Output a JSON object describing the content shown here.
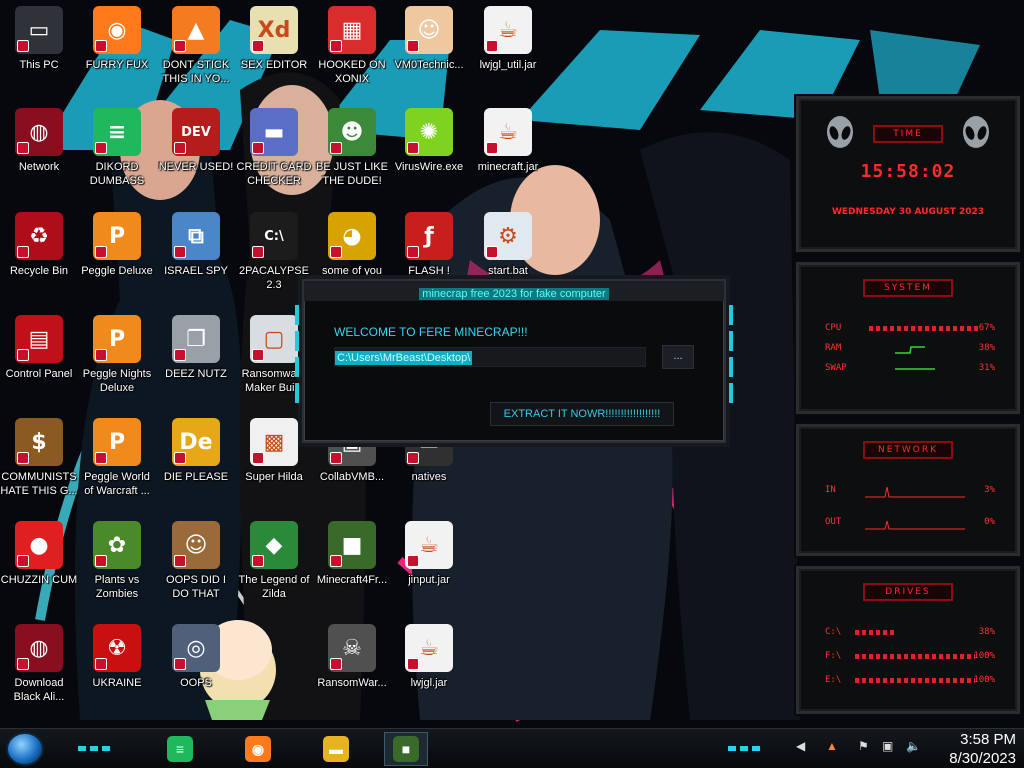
{
  "desktop": {
    "icons": [
      {
        "label": "This PC",
        "icon": "computer-icon",
        "bg": "#30323a"
      },
      {
        "label": "FURRY FUX",
        "icon": "firefox-icon",
        "bg": "#ff7a1a"
      },
      {
        "label": "DONT STICK THIS IN YO...",
        "icon": "traffic-cone-icon",
        "bg": "#f47b20"
      },
      {
        "label": "SEX EDITOR",
        "icon": "hex-editor-icon",
        "bg": "#e8e0b0"
      },
      {
        "label": "HOOKED ON XONIX",
        "icon": "xonix-game-icon",
        "bg": "#d92c2c"
      },
      {
        "label": "VM0Technic...",
        "icon": "doctor-icon",
        "bg": "#f0c8a0"
      },
      {
        "label": "lwjgl_util.jar",
        "icon": "java-icon",
        "bg": "#f2f2f2"
      },
      {
        "label": "Network",
        "icon": "network-icon",
        "bg": "#8a0f1e"
      },
      {
        "label": "DIKORD DUMBASS",
        "icon": "chat-bubble-icon",
        "bg": "#1fb85c"
      },
      {
        "label": "NEVER USED!",
        "icon": "dev-cpp-icon",
        "bg": "#b51c1c"
      },
      {
        "label": "CREDIT CARD CHECKER",
        "icon": "credit-card-icon",
        "bg": "#5a6ec8"
      },
      {
        "label": "BE JUST LIKE THE DUDE!",
        "icon": "santa-face-icon",
        "bg": "#3a8a3a"
      },
      {
        "label": "VirusWire.exe",
        "icon": "lime-icon",
        "bg": "#7ed321"
      },
      {
        "label": "minecraft.jar",
        "icon": "java-icon",
        "bg": "#f2f2f2"
      },
      {
        "label": "Recycle Bin",
        "icon": "recycle-bin-icon",
        "bg": "#b00d1a"
      },
      {
        "label": "Peggle Deluxe",
        "icon": "peggle-icon",
        "bg": "#f08a1c"
      },
      {
        "label": "ISRAEL SPY",
        "icon": "network-computers-icon",
        "bg": "#4a86c8"
      },
      {
        "label": "2PACALYPSE 2.3",
        "icon": "terminal-icon",
        "bg": "#1c1c1c"
      },
      {
        "label": "some of you",
        "icon": "beaver-icon",
        "bg": "#d7a300"
      },
      {
        "label": "FLASH !",
        "icon": "flash-icon",
        "bg": "#c81e1e"
      },
      {
        "label": "start.bat",
        "icon": "gear-script-icon",
        "bg": "#e0e8f0"
      },
      {
        "label": "Control Panel",
        "icon": "control-panel-icon",
        "bg": "#c2101a"
      },
      {
        "label": "Peggle Nights Deluxe",
        "icon": "peggle-icon",
        "bg": "#f08a1c"
      },
      {
        "label": "DEEZ NUTZ",
        "icon": "windows-stack-icon",
        "bg": "#9aa0a8"
      },
      {
        "label": "Ransomware Maker Build",
        "icon": "window-app-icon",
        "bg": "#d8dde2"
      },
      {
        "label": "COMMUNISTS HATE THIS G...",
        "icon": "money-bag-icon",
        "bg": "#8a5a22"
      },
      {
        "label": "Peggle World of Warcraft ...",
        "icon": "peggle-icon",
        "bg": "#f08a1c"
      },
      {
        "label": "DIE PLEASE",
        "icon": "de-icon",
        "bg": "#e6a817"
      },
      {
        "label": "Super Hilda",
        "icon": "pixel-character-icon",
        "bg": "#f0f0f0"
      },
      {
        "label": "CollabVMB...",
        "icon": "collab-icon",
        "bg": "#505050"
      },
      {
        "label": "natives",
        "icon": "folder-icon",
        "bg": "#303030"
      },
      {
        "label": "CHUZZIN CUM",
        "icon": "chuzzle-icon",
        "bg": "#e02020"
      },
      {
        "label": "Plants vs Zombies",
        "icon": "sunflower-icon",
        "bg": "#4a8a2a"
      },
      {
        "label": "OOPS DID I DO THAT",
        "icon": "portrait-icon",
        "bg": "#9a6a3a"
      },
      {
        "label": "The Legend of Zilda",
        "icon": "zelda-icon",
        "bg": "#2a8a3a"
      },
      {
        "label": "Minecraft4Fr...",
        "icon": "grass-block-icon",
        "bg": "#3a6a2a"
      },
      {
        "label": "jinput.jar",
        "icon": "java-icon",
        "bg": "#f2f2f2"
      },
      {
        "label": "Download Black Ali...",
        "icon": "alien-icon",
        "bg": "#8a0f1e"
      },
      {
        "label": "UKRAINE",
        "icon": "radiation-icon",
        "bg": "#c81010"
      },
      {
        "label": "OOPS",
        "icon": "oops-icon",
        "bg": "#50607a"
      },
      {
        "label": "RansomWar...",
        "icon": "skull-icon",
        "bg": "#505050"
      },
      {
        "label": "lwjgl.jar",
        "icon": "java-icon",
        "bg": "#f2f2f2"
      }
    ]
  },
  "window": {
    "title": "minecrap free 2023 for fake computer",
    "welcome": "WELCOME TO FERE MINECRAP!!!",
    "path": "C:\\Users\\MrBeast\\Desktop\\",
    "browse_label": "...",
    "extract_label": "EXTRACT IT NOWR!!!!!!!!!!!!!!!!!!"
  },
  "gadgets": {
    "time": {
      "tag": "TIME",
      "clock": "15:58:02",
      "date": "WEDNESDAY 30 AUGUST 2023"
    },
    "system": {
      "tag": "SYSTEM",
      "rows": [
        {
          "label": "CPU",
          "value": "67%"
        },
        {
          "label": "RAM",
          "value": "38%"
        },
        {
          "label": "SWAP",
          "value": "31%"
        }
      ]
    },
    "network": {
      "tag": "NETWORK",
      "rows": [
        {
          "label": "IN",
          "value": "3%"
        },
        {
          "label": "OUT",
          "value": "0%"
        }
      ]
    },
    "drives": {
      "tag": "DRIVES",
      "rows": [
        {
          "label": "C:\\",
          "value": "38%"
        },
        {
          "label": "F:\\",
          "value": "100%"
        },
        {
          "label": "E:\\",
          "value": "100%"
        }
      ]
    }
  },
  "taskbar": {
    "apps": [
      {
        "name": "Messenger",
        "icon": "chat-bubble-icon",
        "color": "#1fb85c"
      },
      {
        "name": "Firefox",
        "icon": "firefox-icon",
        "color": "#ff7a1a"
      },
      {
        "name": "File Explorer",
        "icon": "folder-icon",
        "color": "#e6b422"
      },
      {
        "name": "Minecraft",
        "icon": "grass-block-icon",
        "color": "#3a6a2a"
      }
    ],
    "time": "3:58 PM",
    "date": "8/30/2023"
  },
  "colors": {
    "accent_cyan": "#36c9e6",
    "gadget_red": "#ff2a2a",
    "wallpaper_cyan": "#1fb6d4",
    "wallpaper_pink": "#ff2a8a"
  }
}
